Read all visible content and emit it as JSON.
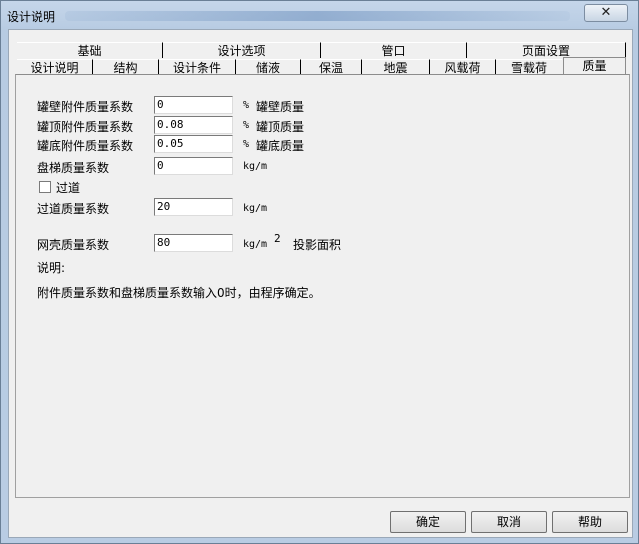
{
  "window": {
    "title": "设计说明",
    "close_glyph": "✕"
  },
  "tabs_top": [
    "基础",
    "设计选项",
    "管口",
    "页面设置"
  ],
  "tabs_bottom": [
    "设计说明",
    "结构",
    "设计条件",
    "储液",
    "保温",
    "地震",
    "风载荷",
    "雪载荷",
    "质量"
  ],
  "active_tab": "质量",
  "fields": {
    "wall_attach": {
      "label": "罐壁附件质量系数",
      "value": "0",
      "unit": "%",
      "unit_label": "罐壁质量"
    },
    "roof_attach": {
      "label": "罐顶附件质量系数",
      "value": "0.08",
      "unit": "%",
      "unit_label": "罐顶质量"
    },
    "bottom_attach": {
      "label": "罐底附件质量系数",
      "value": "0.05",
      "unit": "%",
      "unit_label": "罐底质量"
    },
    "stair": {
      "label": "盘梯质量系数",
      "value": "0",
      "unit": "kg/m"
    },
    "walkway_check": {
      "label": "过道",
      "checked": false
    },
    "walkway": {
      "label": "过道质量系数",
      "value": "20",
      "unit": "kg/m"
    },
    "dome": {
      "label": "网壳质量系数",
      "value": "80",
      "unit": "kg/m",
      "sup": "2",
      "unit_label": "投影面积"
    }
  },
  "note": {
    "heading": "说明:",
    "text": "附件质量系数和盘梯质量系数输入0时，由程序确定。"
  },
  "buttons": {
    "ok": "确定",
    "cancel": "取消",
    "help": "帮助"
  }
}
